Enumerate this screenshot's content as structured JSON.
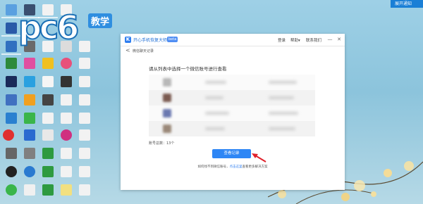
{
  "watermark": {
    "brand": "pc6",
    "tag": "教学"
  },
  "notification": {
    "label": "展开通知"
  },
  "window": {
    "app_title": "开心手机恢复大师",
    "version_badge": "beta",
    "links": [
      "登录",
      "帮助",
      "联系我们"
    ],
    "help_arrow": "▾",
    "controls": {
      "minimize": "—",
      "close": "✕"
    },
    "back_symbol": "<",
    "subtitle": "微信聊天记录",
    "prompt": "请从列表中选择一个微信账号进行查看",
    "account_count": "账号总数：13个",
    "view_button": "查看记录",
    "hint_prefix": "如何找不到微信账号，",
    "hint_link": "点击这里",
    "hint_suffix": "查看更多解决方案"
  },
  "colors": {
    "accent": "#2e86f5",
    "title_blue": "#1f6fd6",
    "arrow_red": "#e0202a"
  }
}
